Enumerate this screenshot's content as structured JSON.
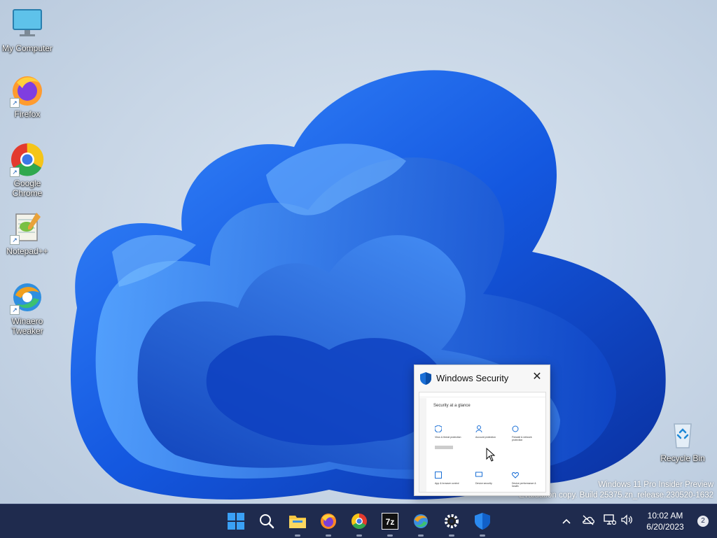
{
  "desktop": {
    "icons": [
      {
        "label_lines": [
          "My Computer"
        ],
        "icon": "monitor-icon"
      },
      {
        "label_lines": [
          "Firefox"
        ],
        "icon": "firefox-icon"
      },
      {
        "label_lines": [
          "Google",
          "Chrome"
        ],
        "icon": "chrome-icon"
      },
      {
        "label_lines": [
          "Notepad++"
        ],
        "icon": "notepad-plus-plus-icon"
      },
      {
        "label_lines": [
          "Winaero",
          "Tweaker"
        ],
        "icon": "winaero-tweaker-icon"
      }
    ],
    "recycle_bin": {
      "label": "Recycle Bin",
      "icon": "recycle-bin-icon"
    }
  },
  "watermark": {
    "line1": "Windows 11 Pro Insider Preview",
    "line2": "Evaluation copy. Build 25375.zn_release.230520-1632"
  },
  "preview": {
    "title": "Windows Security",
    "heading": "Security at a glance",
    "tiles": [
      "Virus & threat protection",
      "Account protection",
      "Firewall & network protection",
      "App & browser control",
      "Device security",
      "Device performance & health"
    ]
  },
  "taskbar": {
    "apps": [
      "start-icon",
      "search-icon",
      "file-explorer-icon",
      "firefox-icon",
      "chrome-icon",
      "7zip-icon",
      "winaero-tweaker-icon",
      "settings-icon",
      "windows-security-icon"
    ],
    "time": "10:02 AM",
    "date": "6/20/2023",
    "notification_count": "2"
  },
  "colors": {
    "taskbar": "#1f2b4e",
    "accent": "#1a5fd0"
  }
}
